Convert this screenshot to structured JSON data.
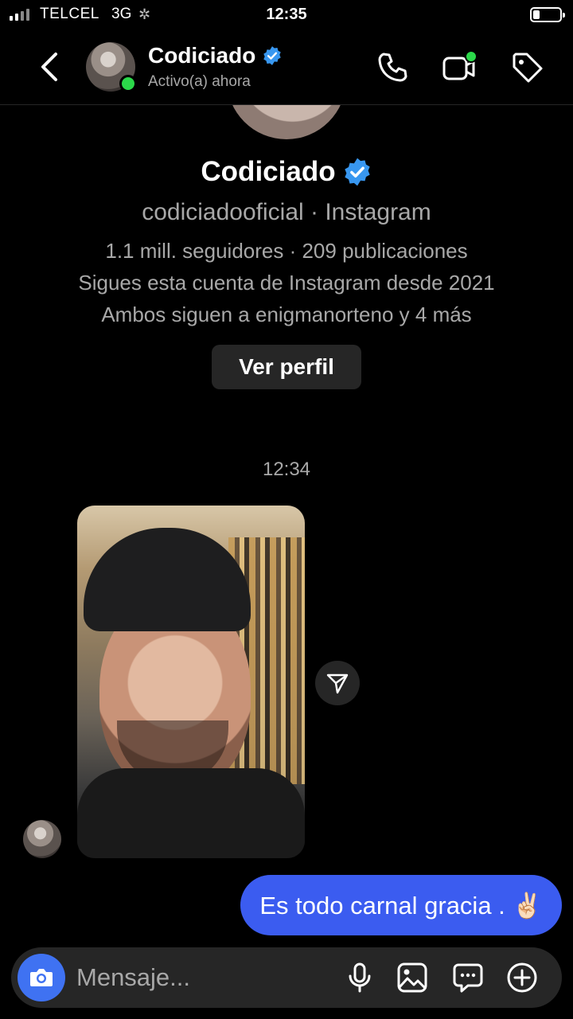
{
  "status_bar": {
    "carrier": "TELCEL",
    "network": "3G",
    "time": "12:35"
  },
  "header": {
    "name": "Codiciado",
    "status": "Activo(a) ahora",
    "verified": true
  },
  "profile": {
    "name": "Codiciado",
    "handle_line": "codiciadooficial · Instagram",
    "stats_line": "1.1 mill. seguidores · 209 publicaciones",
    "following_since": "Sigues esta cuenta de Instagram desde 2021",
    "mutual": "Ambos siguen a enigmanorteno y 4 más",
    "view_profile_label": "Ver perfil"
  },
  "thread": {
    "timestamp": "12:34",
    "sent_message": "Es todo carnal gracia . ✌🏻"
  },
  "composer": {
    "placeholder": "Mensaje..."
  },
  "colors": {
    "background": "#000000",
    "accent_blue": "#3b5cf0",
    "verified_blue": "#3897f0",
    "online_green": "#2bd94a",
    "muted_text": "#a8a8a8",
    "surface": "#262626"
  },
  "icons": {
    "back": "chevron-left-icon",
    "call": "phone-icon",
    "video": "video-call-icon",
    "tag": "tag-icon",
    "share": "send-icon",
    "camera": "camera-icon",
    "mic": "microphone-icon",
    "gallery": "gallery-icon",
    "sticker": "chat-bubble-icon",
    "more": "plus-circle-icon"
  }
}
